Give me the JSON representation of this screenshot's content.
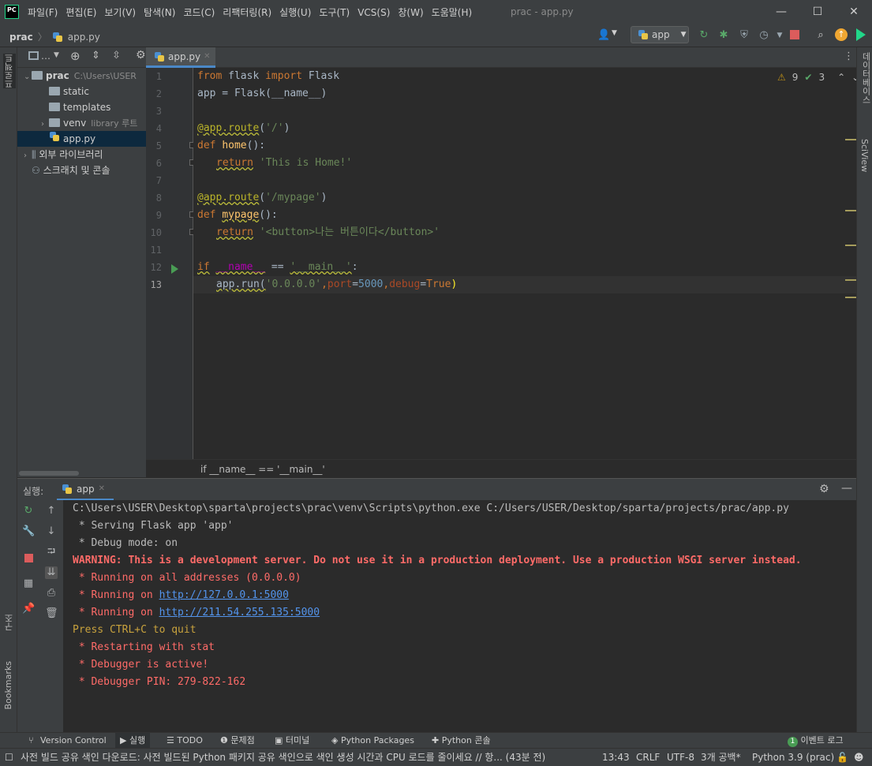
{
  "window": {
    "title": "prac - app.py"
  },
  "menu": [
    "파일(F)",
    "편집(E)",
    "보기(V)",
    "탐색(N)",
    "코드(C)",
    "리팩터링(R)",
    "실행(U)",
    "도구(T)",
    "VCS(S)",
    "창(W)",
    "도움말(H)"
  ],
  "logo": "PC",
  "breadcrumb": {
    "project": "prac",
    "file": "app.py"
  },
  "run_config": {
    "name": "app"
  },
  "left_strip": {
    "project": "프로젝트",
    "structure": "구조",
    "bookmarks": "Bookmarks"
  },
  "right_strip": {
    "database": "데이터베이스",
    "sciview": "SciView"
  },
  "project_tree": [
    {
      "label": "prac",
      "extra": "C:\\Users\\USER"
    },
    {
      "label": "static"
    },
    {
      "label": "templates"
    },
    {
      "label": "venv",
      "extra": "library 루트"
    },
    {
      "label": "app.py"
    },
    {
      "label": "외부 라이브러리"
    },
    {
      "label": "스크래치 및 콘솔"
    }
  ],
  "editor": {
    "tab": "app.py",
    "warnings": "9",
    "weak_warnings": "3",
    "line_numbers": [
      "1",
      "2",
      "3",
      "4",
      "5",
      "6",
      "7",
      "8",
      "9",
      "10",
      "11",
      "12",
      "13"
    ],
    "breadcrumb": "if __name__ == '__main__'",
    "code_tokens": {
      "l1": [
        "from",
        " flask ",
        "import",
        " Flask"
      ],
      "l2": "app = Flask(__name__)",
      "l4": [
        "@app.route",
        "(",
        "'/'",
        ")"
      ],
      "l5": [
        "def",
        " ",
        "home",
        "():"
      ],
      "l6": [
        "return",
        " ",
        "'This is Home!'"
      ],
      "l8": [
        "@app.route",
        "(",
        "'/mypage'",
        ")"
      ],
      "l9": [
        "def",
        " ",
        "mypage",
        "():"
      ],
      "l10": [
        "return",
        " ",
        "'<button>나는 버튼이다</button>'"
      ],
      "l12": [
        "if",
        " ",
        "__name__",
        " == ",
        "'__main__'",
        ":"
      ],
      "l13": [
        "app.run(",
        "'0.0.0.0'",
        ",",
        "port",
        "=",
        "5000",
        ",",
        "debug",
        "=",
        "True",
        ")"
      ]
    }
  },
  "run_panel": {
    "label": "실행:",
    "tab": "app",
    "output": [
      {
        "cls": "cg",
        "text": "C:\\Users\\USER\\Desktop\\sparta\\projects\\prac\\venv\\Scripts\\python.exe C:/Users/USER/Desktop/sparta/projects/prac/app.py"
      },
      {
        "cls": "cg",
        "text": " * Serving Flask app 'app'"
      },
      {
        "cls": "cg",
        "text": " * Debug mode: on"
      },
      {
        "cls": "cw",
        "text": "WARNING: This is a development server. Do not use it in a production deployment. Use a production WSGI server instead."
      },
      {
        "cls": "cr",
        "text": " * Running on all addresses (0.0.0.0)"
      },
      {
        "cls": "cr",
        "text": " * Running on ",
        "link": "http://127.0.0.1:5000"
      },
      {
        "cls": "cr",
        "text": " * Running on ",
        "link": "http://211.54.255.135:5000"
      },
      {
        "cls": "cy",
        "text": "Press CTRL+C to quit"
      },
      {
        "cls": "cr",
        "text": " * Restarting with stat"
      },
      {
        "cls": "cr",
        "text": " * Debugger is active!"
      },
      {
        "cls": "cr",
        "text": " * Debugger PIN: 279-822-162"
      }
    ]
  },
  "bottom_tools": [
    "Version Control",
    "실행",
    "TODO",
    "문제점",
    "터미널",
    "Python Packages",
    "Python 콘솔"
  ],
  "event_log": {
    "count": "1",
    "label": "이벤트 로그"
  },
  "status": {
    "message": "사전 빌드 공유 색인 다운로드: 사전 빌드된 Python 패키지 공유 색인으로 색인 생성 시간과 CPU 로드를 줄이세요 // 항... (43분 전)",
    "position": "13:43",
    "line_sep": "CRLF",
    "encoding": "UTF-8",
    "indent": "3개 공백*",
    "interpreter": "Python 3.9 (prac)"
  },
  "colors": {
    "accent": "#4a88c7",
    "keyword": "#cc7832",
    "string": "#6a8759",
    "error": "#ff6b68"
  }
}
